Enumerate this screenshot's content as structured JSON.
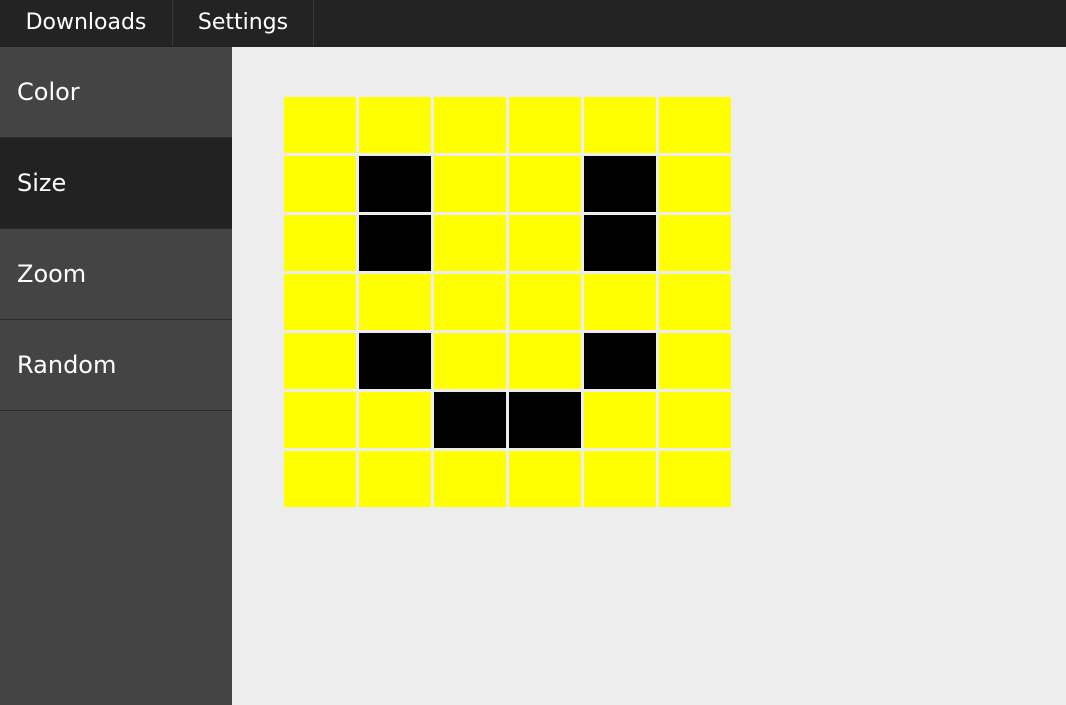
{
  "topbar": {
    "tabs": [
      {
        "label": "Downloads"
      },
      {
        "label": "Settings"
      }
    ]
  },
  "sidebar": {
    "items": [
      {
        "label": "Color",
        "active": false
      },
      {
        "label": "Size",
        "active": true
      },
      {
        "label": "Zoom",
        "active": false
      },
      {
        "label": "Random",
        "active": false
      }
    ]
  },
  "canvas": {
    "rows": 7,
    "cols": 6,
    "palette": {
      "fill": "#ffff00",
      "ink": "#000000"
    },
    "pixels": [
      [
        0,
        0,
        0,
        0,
        0,
        0
      ],
      [
        0,
        1,
        0,
        0,
        1,
        0
      ],
      [
        0,
        1,
        0,
        0,
        1,
        0
      ],
      [
        0,
        0,
        0,
        0,
        0,
        0
      ],
      [
        0,
        1,
        0,
        0,
        1,
        0
      ],
      [
        0,
        0,
        1,
        1,
        0,
        0
      ],
      [
        0,
        0,
        0,
        0,
        0,
        0
      ]
    ]
  }
}
